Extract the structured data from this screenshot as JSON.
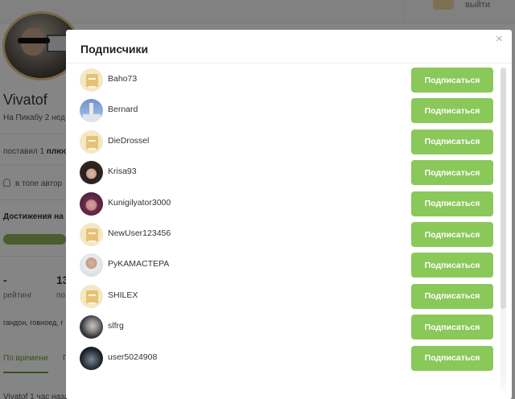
{
  "background": {
    "logout_label": "выйти",
    "profile_name": "Vivatof",
    "since_text": "На Пикабу 2 нед",
    "plus_text": "поставил 1 ",
    "plus_bold": "плюс",
    "top_text": "в топе автор",
    "achievements_label": "Достижения на",
    "rating_value": "-",
    "rating_label": "рейтинг",
    "second_stat_value": "13",
    "second_stat_label": "по",
    "tags_text": "гандон, говноед, г",
    "tab_active": "По времени",
    "tab_second": "Г",
    "post_author": "Vivatof",
    "post_meta": "1 час назад"
  },
  "modal": {
    "title": "Подписчики",
    "close_glyph": "×",
    "subscribe_label": "Подписаться",
    "subscribers": [
      {
        "username": "Baho73",
        "avatar": "default"
      },
      {
        "username": "Bernard",
        "avatar": "blue"
      },
      {
        "username": "DieDrossel",
        "avatar": "default"
      },
      {
        "username": "Krisa93",
        "avatar": "hair"
      },
      {
        "username": "Kunigilyator3000",
        "avatar": "pink"
      },
      {
        "username": "NewUser123456",
        "avatar": "default"
      },
      {
        "username": "PyKAMACTEPA",
        "avatar": "man"
      },
      {
        "username": "SHILEX",
        "avatar": "default"
      },
      {
        "username": "slfrg",
        "avatar": "manb"
      },
      {
        "username": "user5024908",
        "avatar": "dark"
      }
    ]
  },
  "colors": {
    "button_green": "#8ac85a",
    "accent_green": "#6b9b36",
    "overlay": "rgba(0,0,0,0.48)"
  }
}
